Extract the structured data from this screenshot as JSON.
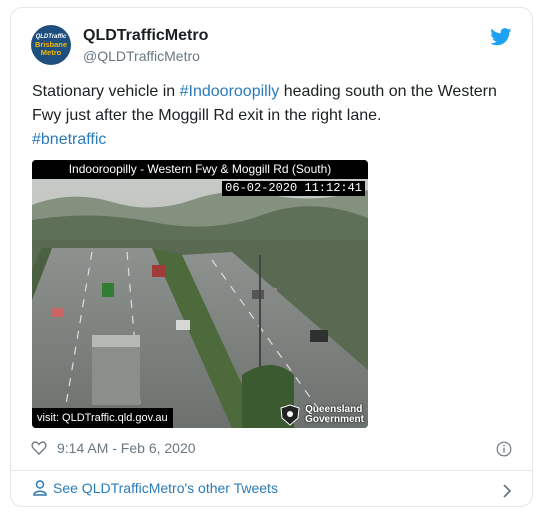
{
  "account": {
    "avatar_lines": [
      "QLDTraffic",
      "Brisbane",
      "Metro"
    ],
    "name": "QLDTrafficMetro",
    "handle": "@QLDTrafficMetro"
  },
  "tweet": {
    "text_1": "Stationary vehicle in ",
    "hashtag_1": "#Indooroopilly",
    "text_2": " heading south on the Western Fwy just after the Moggill Rd exit in the right lane.",
    "hashtag_2": "#bnetraffic"
  },
  "camera": {
    "title": "Indooroopilly - Western Fwy & Moggill Rd (South)",
    "timestamp": "06-02-2020 11:12:41",
    "visit": "visit: QLDTraffic.qld.gov.au",
    "logo_lines": [
      "Queensland",
      "Government"
    ]
  },
  "meta": {
    "time": "9:14 AM - Feb 6, 2020"
  },
  "footer": {
    "label": "See QLDTrafficMetro's other Tweets"
  },
  "icons": {
    "bird": "twitter-bird-icon",
    "heart": "heart-icon",
    "info": "info-icon",
    "person": "person-icon",
    "chevron": "chevron-right-icon"
  },
  "colors": {
    "link": "#2b7bb9",
    "brand": "#1da1f2",
    "muted": "#697882",
    "avatar_bg": "#1f4f7e",
    "avatar_accent": "#f2b705"
  }
}
